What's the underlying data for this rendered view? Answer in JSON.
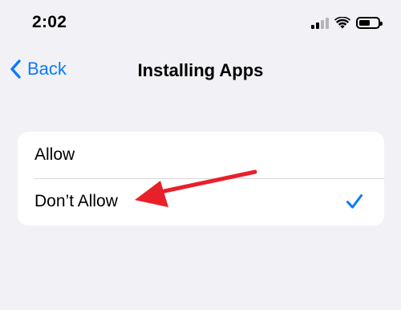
{
  "status_bar": {
    "time": "2:02",
    "icons": [
      "cellular-signal-icon",
      "wifi-icon",
      "battery-icon"
    ]
  },
  "nav": {
    "back_label": "Back",
    "title": "Installing Apps",
    "accent_color": "#0a7aff"
  },
  "options": {
    "items": [
      {
        "label": "Allow",
        "selected": false
      },
      {
        "label": "Don’t Allow",
        "selected": true
      }
    ]
  },
  "annotation": {
    "type": "arrow",
    "color": "#e8202a",
    "points_to": "Don’t Allow"
  }
}
